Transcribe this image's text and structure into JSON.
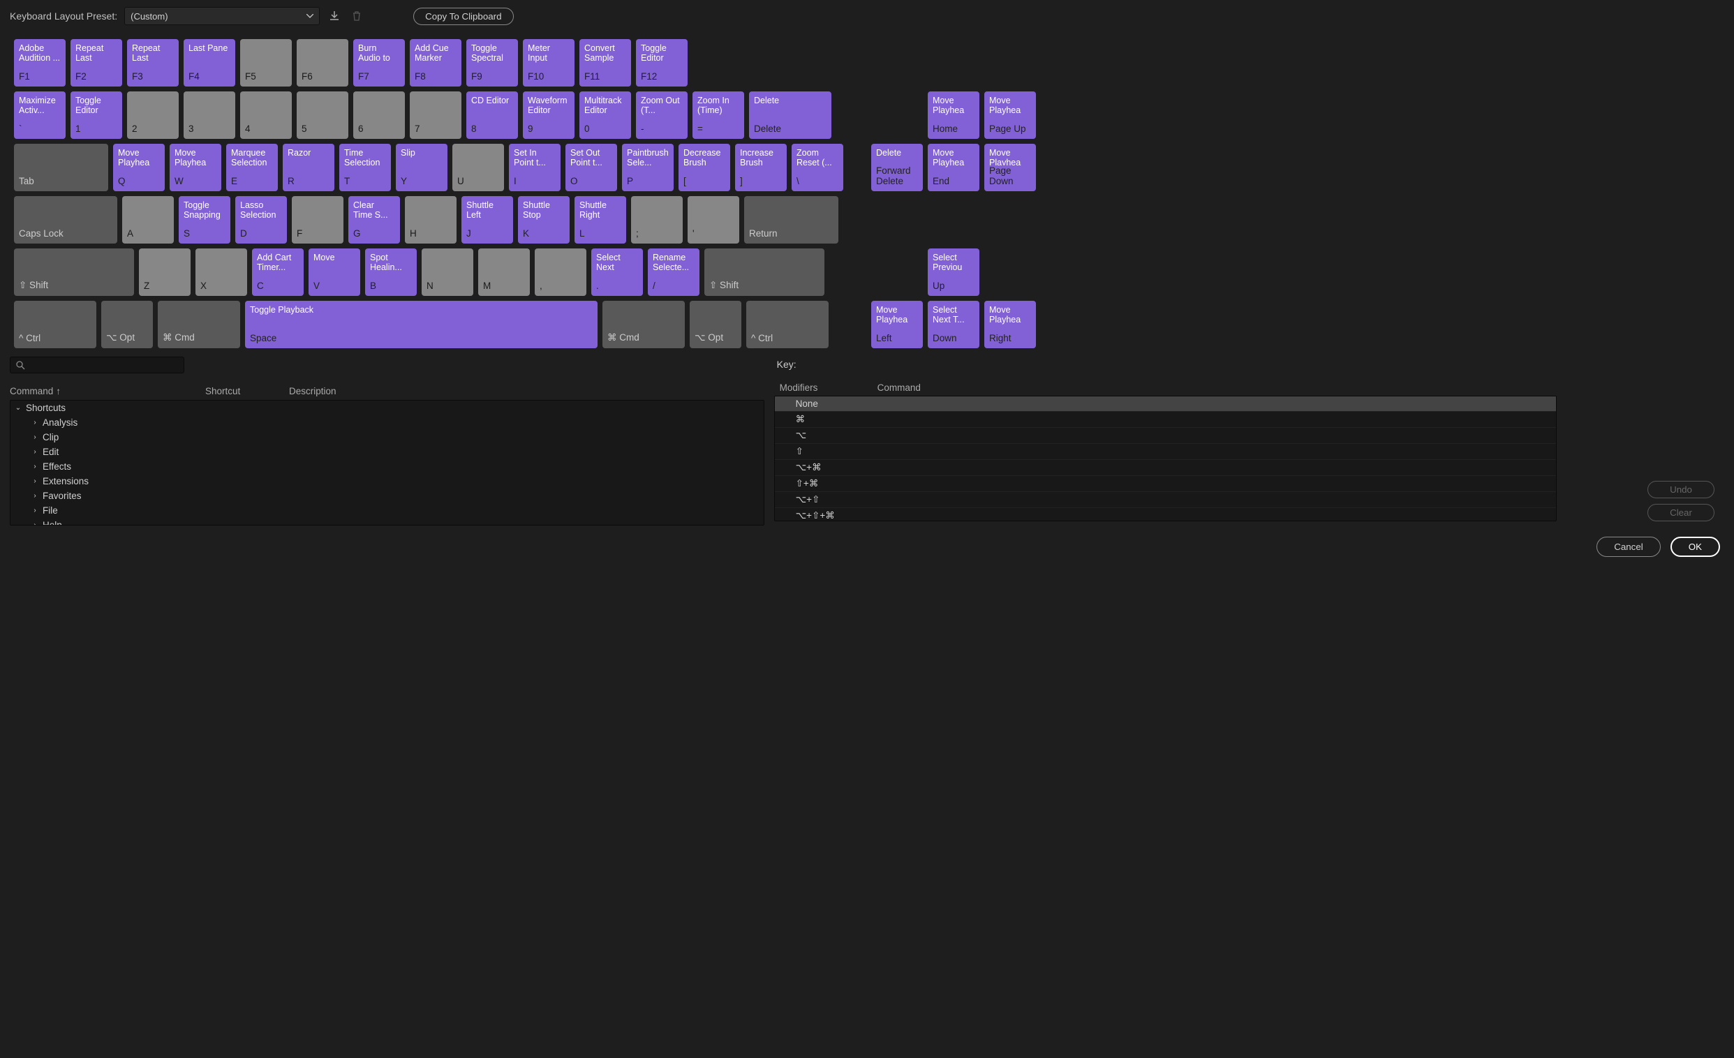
{
  "toolbar": {
    "label": "Keyboard Layout Preset:",
    "preset": "(Custom)",
    "copy": "Copy To Clipboard"
  },
  "rows": {
    "f": [
      {
        "c": "Adobe Audition ...",
        "l": "F1",
        "p": 1
      },
      {
        "c": "Repeat Last Command",
        "l": "F2",
        "p": 1
      },
      {
        "c": "Repeat Last Command...",
        "l": "F3",
        "p": 1
      },
      {
        "c": "Last Pane",
        "l": "F4",
        "p": 1
      },
      {
        "c": "",
        "l": "F5",
        "p": 0
      },
      {
        "c": "",
        "l": "F6",
        "p": 0
      },
      {
        "c": "Burn Audio to CD",
        "l": "F7",
        "p": 1
      },
      {
        "c": "Add Cue Marker",
        "l": "F8",
        "p": 1
      },
      {
        "c": "Toggle Spectral F...",
        "l": "F9",
        "p": 1
      },
      {
        "c": "Meter Input Signal",
        "l": "F10",
        "p": 1
      },
      {
        "c": "Convert Sample T...",
        "l": "F11",
        "p": 1
      },
      {
        "c": "Toggle Editor",
        "l": "F12",
        "p": 1
      }
    ],
    "num": [
      {
        "c": "Maximize Activ...",
        "l": "`",
        "p": 1
      },
      {
        "c": "Toggle Editor",
        "l": "1",
        "p": 1
      },
      {
        "c": "",
        "l": "2",
        "p": 0
      },
      {
        "c": "",
        "l": "3",
        "p": 0
      },
      {
        "c": "",
        "l": "4",
        "p": 0
      },
      {
        "c": "",
        "l": "5",
        "p": 0
      },
      {
        "c": "",
        "l": "6",
        "p": 0
      },
      {
        "c": "",
        "l": "7",
        "p": 0
      },
      {
        "c": "CD Editor",
        "l": "8",
        "p": 1
      },
      {
        "c": "Waveform Editor",
        "l": "9",
        "p": 1
      },
      {
        "c": "Multitrack Editor",
        "l": "0",
        "p": 1
      },
      {
        "c": "Zoom Out (T...",
        "l": "-",
        "p": 1
      },
      {
        "c": "Zoom In (Time)",
        "l": "=",
        "p": 1
      },
      {
        "c": "Delete",
        "l": "Delete",
        "p": 1,
        "w": "w15"
      }
    ],
    "numSide": [
      {
        "c": "Move Playhea",
        "l": "Home",
        "p": 1
      },
      {
        "c": "Move Playhea",
        "l": "Page Up",
        "p": 1
      }
    ],
    "q": [
      {
        "c": "",
        "l": "Tab",
        "p": 0,
        "w": "w175",
        "dk": 1
      },
      {
        "c": "Move Playhea",
        "l": "Q",
        "p": 1
      },
      {
        "c": "Move Playhea",
        "l": "W",
        "p": 1
      },
      {
        "c": "Marquee Selection",
        "l": "E",
        "p": 1
      },
      {
        "c": "Razor",
        "l": "R",
        "p": 1
      },
      {
        "c": "Time Selection",
        "l": "T",
        "p": 1
      },
      {
        "c": "Slip",
        "l": "Y",
        "p": 1
      },
      {
        "c": "",
        "l": "U",
        "p": 0
      },
      {
        "c": "Set In Point t...",
        "l": "I",
        "p": 1
      },
      {
        "c": "Set Out Point t...",
        "l": "O",
        "p": 1
      },
      {
        "c": "Paintbrush Sele...",
        "l": "P",
        "p": 1
      },
      {
        "c": "Decrease Brush",
        "l": "[",
        "p": 1
      },
      {
        "c": "Increase Brush",
        "l": "]",
        "p": 1
      },
      {
        "c": "Zoom Reset (...",
        "l": "\\",
        "p": 1
      }
    ],
    "qSide": [
      {
        "c": "Delete",
        "l": "Forward Delete",
        "p": 1
      },
      {
        "c": "Move Playhea",
        "l": "End",
        "p": 1
      },
      {
        "c": "Move Playhea",
        "l": "Page Down",
        "p": 1
      }
    ],
    "a": [
      {
        "c": "",
        "l": "Caps Lock",
        "p": 0,
        "w": "w2",
        "dk": 1
      },
      {
        "c": "",
        "l": "A",
        "p": 0
      },
      {
        "c": "Toggle Snapping",
        "l": "S",
        "p": 1
      },
      {
        "c": "Lasso Selection",
        "l": "D",
        "p": 1
      },
      {
        "c": "",
        "l": "F",
        "p": 0
      },
      {
        "c": "Clear Time S...",
        "l": "G",
        "p": 1
      },
      {
        "c": "",
        "l": "H",
        "p": 0
      },
      {
        "c": "Shuttle Left",
        "l": "J",
        "p": 1
      },
      {
        "c": "Shuttle Stop",
        "l": "K",
        "p": 1
      },
      {
        "c": "Shuttle Right",
        "l": "L",
        "p": 1
      },
      {
        "c": "",
        "l": ";",
        "p": 0
      },
      {
        "c": "",
        "l": "'",
        "p": 0
      },
      {
        "c": "",
        "l": "Return",
        "p": 0,
        "w": "w175",
        "dk": 1
      }
    ],
    "z": [
      {
        "c": "",
        "l": "⇧ Shift",
        "p": 0,
        "w": "w225",
        "dk": 1
      },
      {
        "c": "",
        "l": "Z",
        "p": 0
      },
      {
        "c": "",
        "l": "X",
        "p": 0
      },
      {
        "c": "Add Cart Timer...",
        "l": "C",
        "p": 1
      },
      {
        "c": "Move",
        "l": "V",
        "p": 1
      },
      {
        "c": "Spot Healin...",
        "l": "B",
        "p": 1
      },
      {
        "c": "",
        "l": "N",
        "p": 0
      },
      {
        "c": "",
        "l": "M",
        "p": 0
      },
      {
        "c": "",
        "l": ",",
        "p": 0
      },
      {
        "c": "Select Next",
        "l": ".",
        "p": 1
      },
      {
        "c": "Rename Selecte...",
        "l": "/",
        "p": 1
      },
      {
        "c": "",
        "l": "⇧ Shift",
        "p": 0,
        "w": "w225",
        "dk": 1
      }
    ],
    "zSide": [
      {
        "c": "Select Previou",
        "l": "Up",
        "p": 1
      }
    ],
    "sp": [
      {
        "c": "",
        "l": "^ Ctrl",
        "p": 0,
        "w": "w15",
        "dk": 1
      },
      {
        "c": "",
        "l": "⌥ Opt",
        "p": 0,
        "dk": 1
      },
      {
        "c": "",
        "l": "⌘ Cmd",
        "p": 0,
        "w": "w15",
        "dk": 1
      },
      {
        "c": "Toggle Playback",
        "l": "Space",
        "p": 1,
        "w": "space"
      },
      {
        "c": "",
        "l": "⌘ Cmd",
        "p": 0,
        "w": "w15",
        "dk": 1
      },
      {
        "c": "",
        "l": "⌥ Opt",
        "p": 0,
        "dk": 1
      },
      {
        "c": "",
        "l": "^ Ctrl",
        "p": 0,
        "w": "w15",
        "dk": 1
      }
    ],
    "spSide": [
      {
        "c": "Move Playhea",
        "l": "Left",
        "p": 1
      },
      {
        "c": "Select Next T...",
        "l": "Down",
        "p": 1
      },
      {
        "c": "Move Playhea",
        "l": "Right",
        "p": 1
      }
    ]
  },
  "headers": {
    "cmd": "Command",
    "shortcut": "Shortcut",
    "desc": "Description",
    "key": "Key:",
    "mods": "Modifiers",
    "cmd2": "Command"
  },
  "tree": [
    {
      "t": "Shortcuts",
      "exp": 1,
      "lvl": 0
    },
    {
      "t": "Analysis",
      "exp": 0,
      "lvl": 1
    },
    {
      "t": "Clip",
      "exp": 0,
      "lvl": 1
    },
    {
      "t": "Edit",
      "exp": 0,
      "lvl": 1
    },
    {
      "t": "Effects",
      "exp": 0,
      "lvl": 1
    },
    {
      "t": "Extensions",
      "exp": 0,
      "lvl": 1
    },
    {
      "t": "Favorites",
      "exp": 0,
      "lvl": 1
    },
    {
      "t": "File",
      "exp": 0,
      "lvl": 1
    },
    {
      "t": "Help",
      "exp": 0,
      "lvl": 1
    }
  ],
  "mods": [
    "None",
    "⌘",
    "⌥",
    "⇧",
    "⌥+⌘",
    "⇧+⌘",
    "⌥+⇧",
    "⌥+⇧+⌘",
    "^",
    "^+⌘"
  ],
  "buttons": {
    "undo": "Undo",
    "clear": "Clear",
    "cancel": "Cancel",
    "ok": "OK"
  }
}
